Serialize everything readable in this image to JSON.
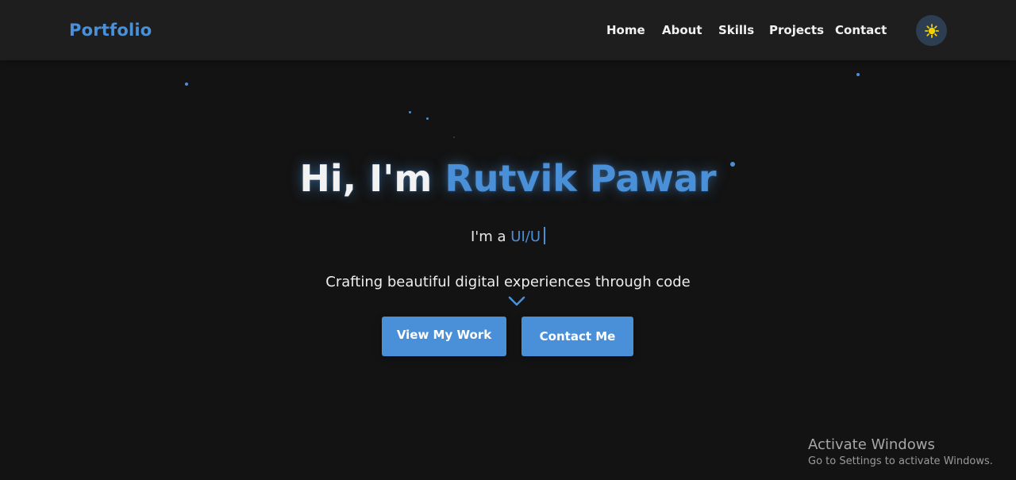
{
  "nav": {
    "logo": "Portfolio",
    "links": [
      "Home",
      "About",
      "Skills",
      "Projects",
      "Contact"
    ],
    "theme_toggle_icon": "sun-icon"
  },
  "hero": {
    "greeting": "Hi, I'm ",
    "name": "Rutvik Pawar",
    "typing_prefix": "I'm a ",
    "typing_text": "UI/U",
    "tagline": "Crafting beautiful digital experiences through code",
    "scroll_icon": "chevron-down-icon"
  },
  "buttons": {
    "view_work": "View My Work",
    "contact_me": "Contact Me"
  },
  "watermark": {
    "title": "Activate Windows",
    "subtitle": "Go to Settings to activate Windows."
  },
  "colors": {
    "accent": "#4a90d9",
    "background": "#131313",
    "navbar": "#1e1e1e",
    "sun": "#f5d000"
  }
}
